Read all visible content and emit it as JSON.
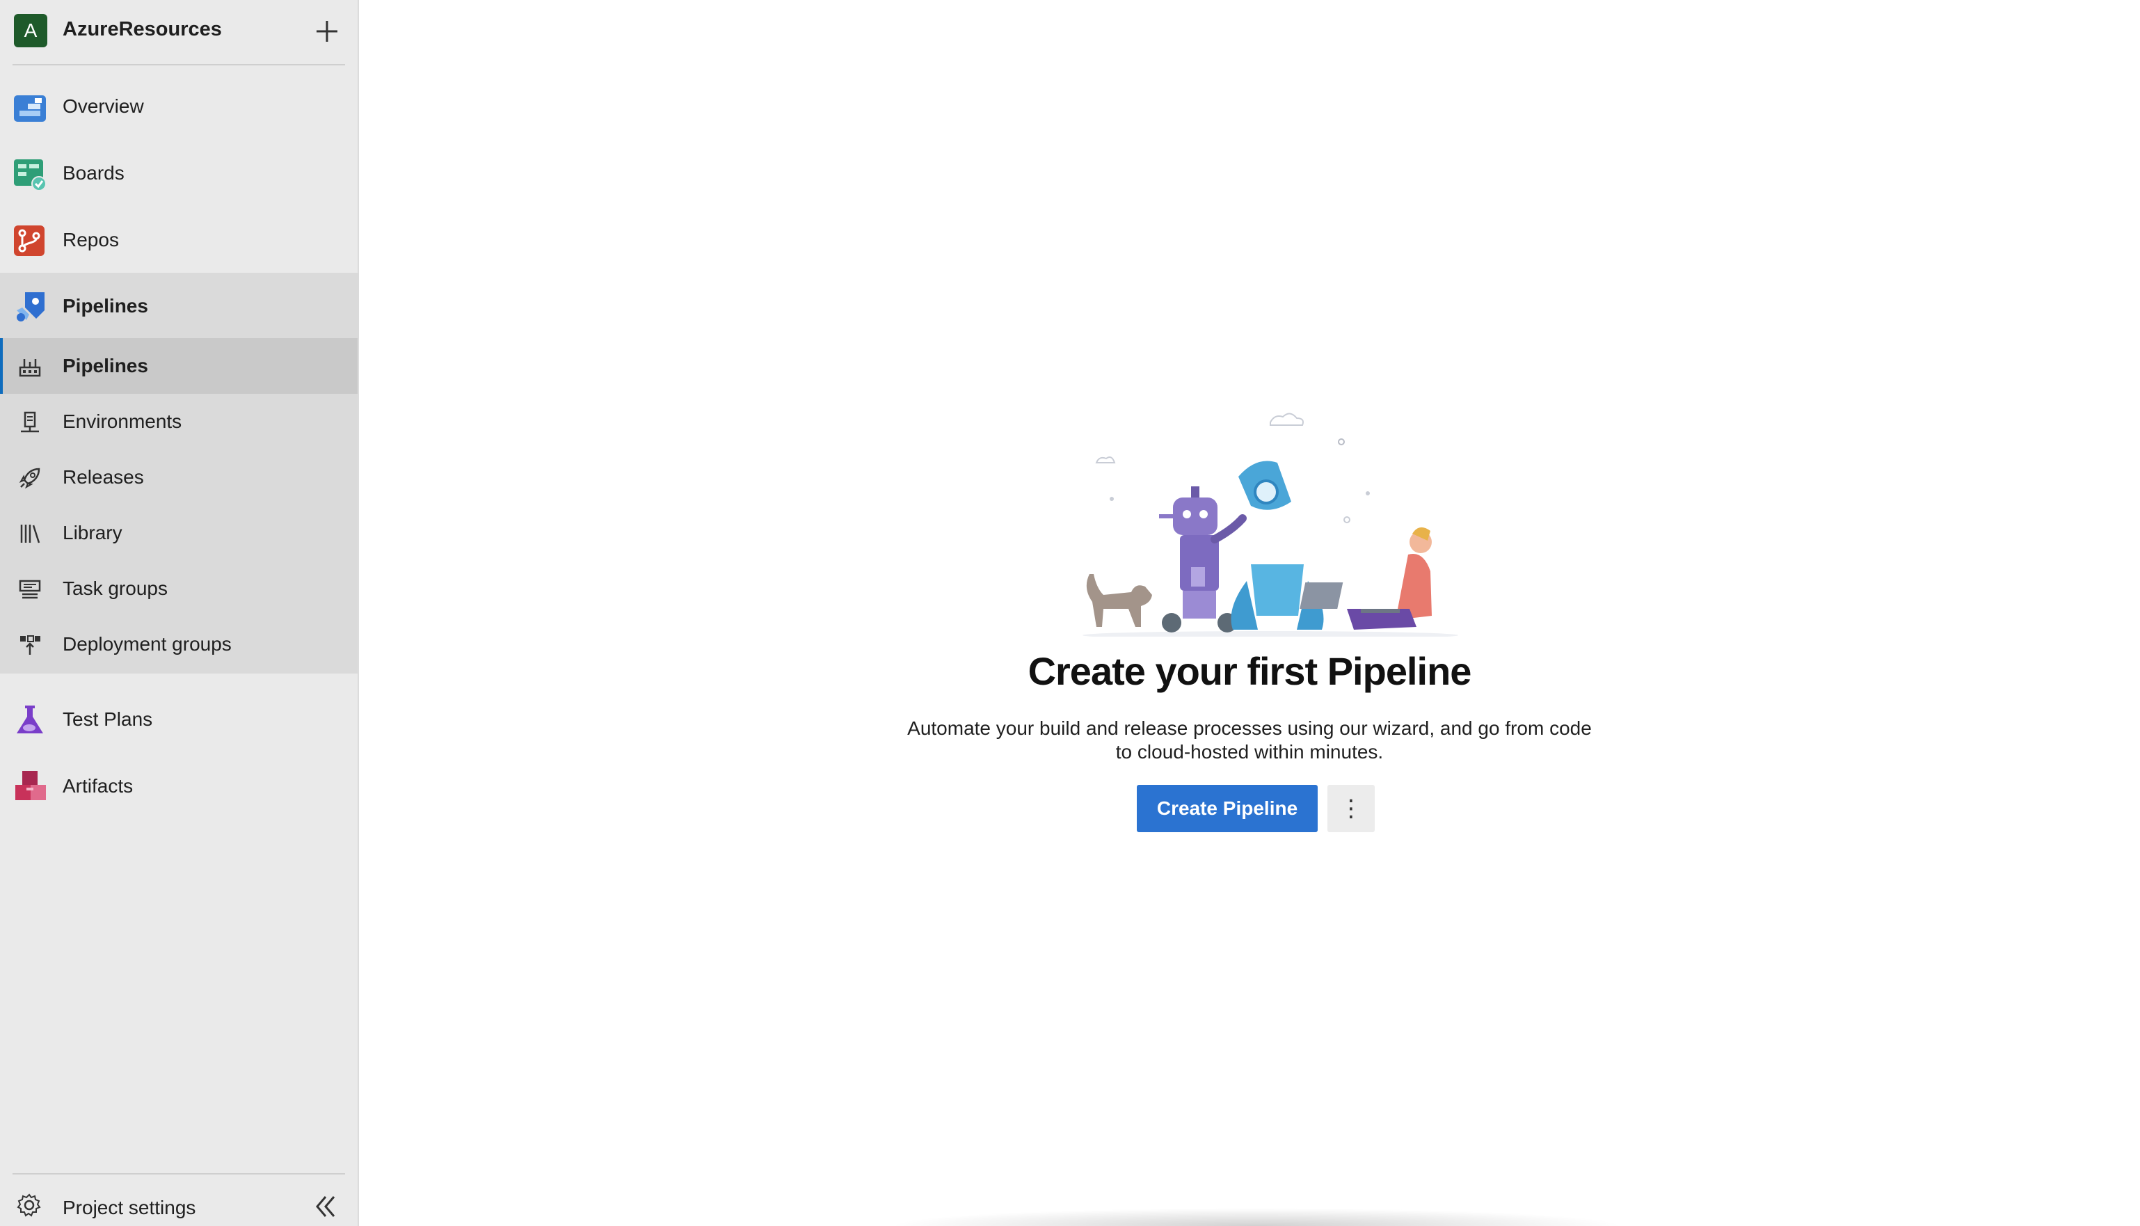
{
  "sidebar": {
    "org": {
      "initial": "A",
      "name": "AzureResources"
    },
    "items": [
      {
        "label": "Overview",
        "icon": "overview-icon"
      },
      {
        "label": "Boards",
        "icon": "boards-icon"
      },
      {
        "label": "Repos",
        "icon": "repos-icon"
      },
      {
        "label": "Pipelines",
        "icon": "pipelines-icon",
        "active": true
      },
      {
        "label": "Test Plans",
        "icon": "test-plans-icon"
      },
      {
        "label": "Artifacts",
        "icon": "artifacts-icon"
      }
    ],
    "sub_items": [
      {
        "label": "Pipelines",
        "icon": "pipeline-sub-icon",
        "selected": true
      },
      {
        "label": "Environments",
        "icon": "environments-icon"
      },
      {
        "label": "Releases",
        "icon": "rocket-icon"
      },
      {
        "label": "Library",
        "icon": "library-icon"
      },
      {
        "label": "Task groups",
        "icon": "task-groups-icon"
      },
      {
        "label": "Deployment groups",
        "icon": "deployment-groups-icon"
      }
    ],
    "settings_label": "Project settings"
  },
  "main": {
    "title": "Create your first Pipeline",
    "subtitle": "Automate your build and release processes using our wizard, and go from code to cloud-hosted within minutes.",
    "create_label": "Create Pipeline",
    "more_label": "⋮"
  },
  "colors": {
    "accent": "#2b73d1",
    "org_avatar": "#1e5a2a",
    "sidebar_bg": "#eaeaea",
    "sidebar_active": "#dadada",
    "sidebar_selected": "#c9c9c9"
  }
}
